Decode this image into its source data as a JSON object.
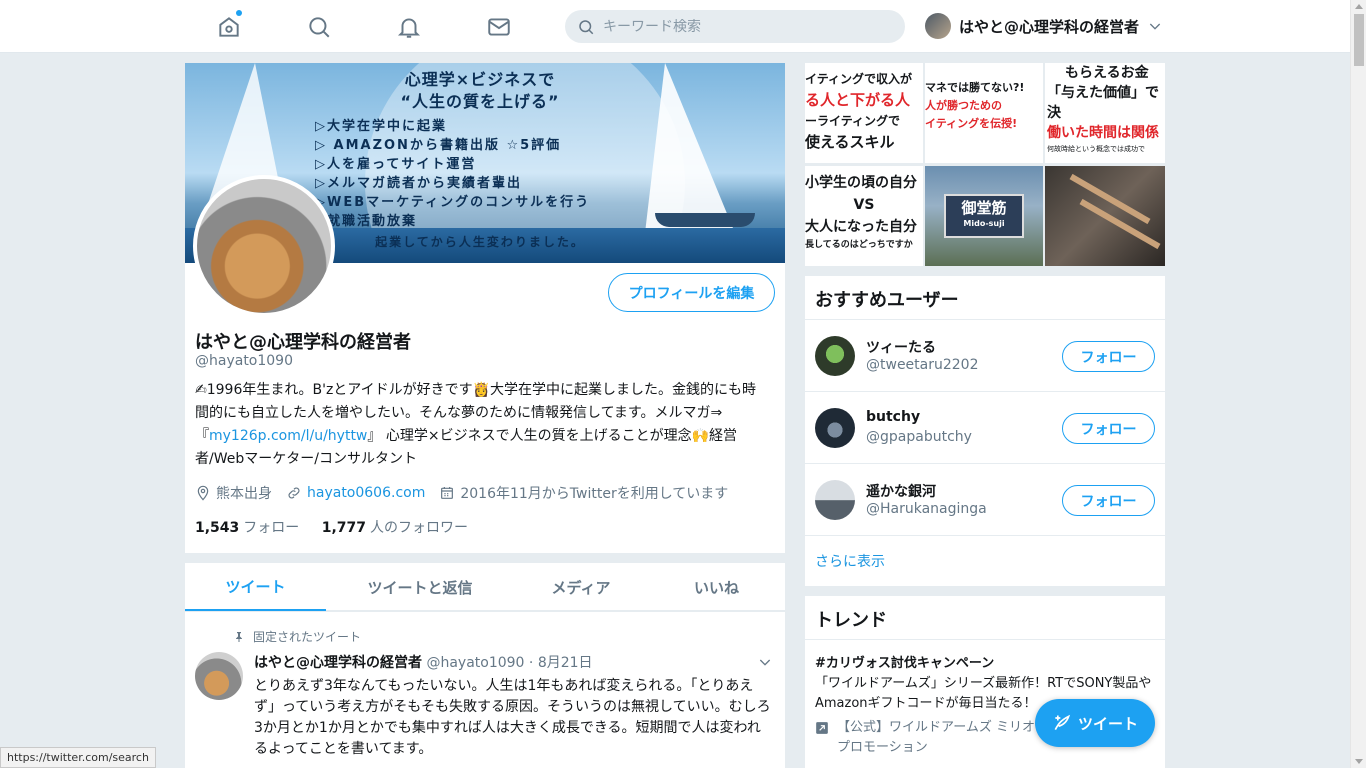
{
  "nav": {
    "search_placeholder": "キーワード検索",
    "account_name": "はやと@心理学科の経営者"
  },
  "banner": {
    "title_line1": "心理学×ビジネスで",
    "title_line2": "“人生の質を上げる”",
    "items": [
      "▷大学在学中に起業",
      "▷ AMAZONから書籍出版 ☆5評価",
      "▷人を雇ってサイト運営",
      "▷メルマガ読者から実績者輩出",
      "▷WEBマーケティングのコンサルを行う",
      "▷就職活動放棄"
    ],
    "footer": "起業してから人生変わりました。"
  },
  "profile": {
    "edit_button": "プロフィールを編集",
    "name": "はやと@心理学科の経営者",
    "handle": "@hayato1090",
    "bio_part1": "✍1996年生まれ。B'zとアイドルが好きです👸大学在学中に起業しました。金銭的にも時間的にも自立した人を増やしたい。そんな夢のために情報発信してます。メルマガ⇒『",
    "bio_link": "my126p.com/l/u/hyttw",
    "bio_part2": "』 心理学×ビジネスで人生の質を上げることが理念🙌経営者/Webマーケター/コンサルタント",
    "location": "熊本出身",
    "website": "hayato0606.com",
    "joined": "2016年11月からTwitterを利用しています",
    "following_count": "1,543",
    "following_label": "フォロー",
    "followers_count": "1,777",
    "followers_label": "人のフォロワー"
  },
  "tabs": [
    "ツイート",
    "ツイートと返信",
    "メディア",
    "いいね"
  ],
  "tweet": {
    "pinned_label": "固定されたツイート",
    "author": "はやと@心理学科の経営者",
    "handle": "@hayato1090",
    "separator": "·",
    "date": "8月21日",
    "text": "とりあえず3年なんてもったいない。人生は1年もあれば変えられる。「とりあえず」っていう考え方がそもそも失敗する原因。そういうのは無視していい。むしろ3か月とか1か月とかでも集中すれば人は大きく成長できる。短期間で人は変われるよってことを書いてます。"
  },
  "media": {
    "t1_lines": [
      "イティングで収入が",
      "る人と下がる人",
      "ーライティングで",
      "使えるスキル"
    ],
    "t2_lines": [
      "マネでは勝てない?!",
      "人が勝つための",
      "イティングを伝授!"
    ],
    "t3_lines": [
      "もらえるお金",
      "「与えた価値」で決",
      "働いた時間は関係",
      "何故時給という概念では成功で"
    ],
    "t4_lines": [
      "小学生の頃の自分",
      "VS",
      "大人になった自分",
      "長してるのはどっちですか"
    ],
    "t5_sign": "御堂筋",
    "t5_sign_sub": "Mido-suji"
  },
  "who_to_follow": {
    "title": "おすすめユーザー",
    "follow_label": "フォロー",
    "users": [
      {
        "name": "ツィーたる",
        "handle": "@tweetaru2202"
      },
      {
        "name": "butchy",
        "handle": "@gpapabutchy"
      },
      {
        "name": "遥かな銀河",
        "handle": "@Harukanaginga"
      }
    ],
    "more": "さらに表示"
  },
  "trends": {
    "title": "トレンド",
    "items": [
      {
        "name": "#カリヴォス討伐キャンペーン",
        "desc": "「ワイルドアームズ」シリーズ最新作！RTでSONY製品やAmazonギフトコードが毎日当たる！",
        "promoted_by": "【公式】ワイルドアームズ ミリオ",
        "promoted_label": "プロモーション"
      }
    ]
  },
  "fab": {
    "label": "ツイート"
  },
  "status_url": "https://twitter.com/search",
  "colors": {
    "accent": "#1da1f2",
    "link": "#1b95e0",
    "background": "#e6ecf0"
  }
}
